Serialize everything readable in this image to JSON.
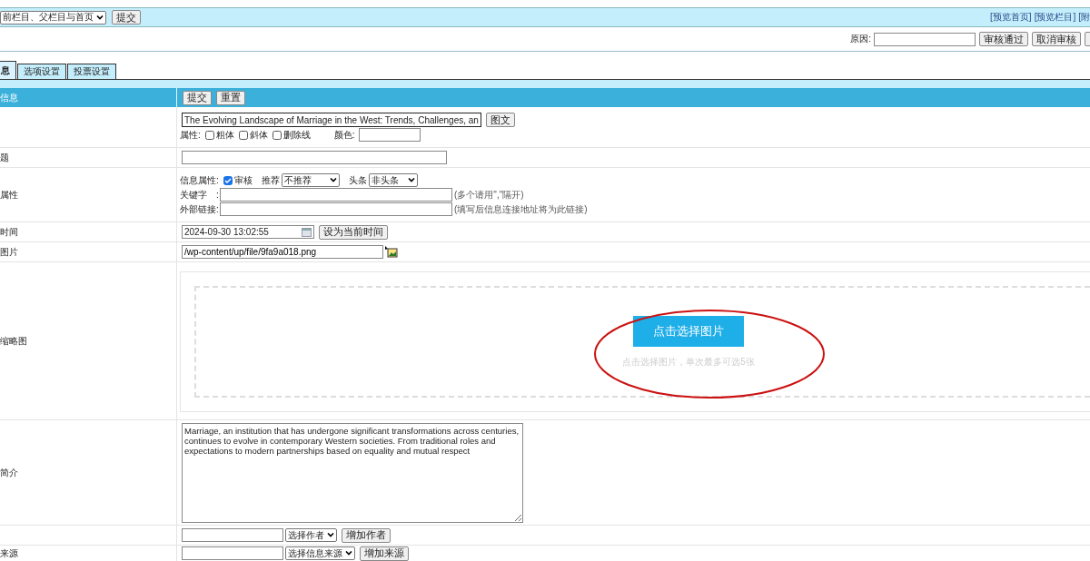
{
  "toolbar": {
    "scope_select": "前栏目、父栏目与首页",
    "submit": "提交",
    "links": [
      "[预览首页]",
      "[预览栏目]",
      "[附"
    ]
  },
  "review": {
    "reason_label": "原因:",
    "buttons": [
      "审核通过",
      "取消审核"
    ]
  },
  "tabs": [
    {
      "label": "息",
      "selected": true
    },
    {
      "label": "选项设置",
      "selected": false
    },
    {
      "label": "投票设置",
      "selected": false
    }
  ],
  "header": {
    "label": "信息",
    "buttons": [
      "提交",
      "重置"
    ]
  },
  "title_row": {
    "value": "The Evolving Landscape of Marriage in the West: Trends, Challenges, an",
    "button": "图文",
    "attr_label": "属性:",
    "styles": [
      {
        "label": "粗体",
        "checked": false
      },
      {
        "label": "斜体",
        "checked": false
      },
      {
        "label": "删除线",
        "checked": false
      }
    ],
    "color_label": "颜色:"
  },
  "subtitle_row": {
    "label": "题"
  },
  "attr_row": {
    "label": "属性",
    "info_label": "信息属性:",
    "review_check": {
      "label": "审核",
      "checked": true
    },
    "recommend_label": "推荐",
    "recommend": "不推荐",
    "headline_label": "头条",
    "headline": "非头条",
    "keyword_label": "关键字　:",
    "keyword_hint": "(多个请用\",\"隔开)",
    "link_label": "外部链接:",
    "link_hint": "(填写后信息连接地址将为此链接)"
  },
  "time_row": {
    "label": "时间",
    "value": "2024-09-30 13:02:55",
    "button": "设为当前时间"
  },
  "picture_row": {
    "label": "图片",
    "value": "/wp-content/up/file/9fa9a018.png"
  },
  "thumb_row": {
    "label": "缩略图",
    "button": "点击选择图片",
    "hint": "点击选择图片，单次最多可选5张"
  },
  "intro_row": {
    "label": "简介",
    "value": "Marriage, an institution that has undergone significant transformations across centuries, continues to evolve in contemporary Western societies. From traditional roles and expectations to modern partnerships based on equality and mutual respect"
  },
  "author_row": {
    "select": "选择作者",
    "button": "增加作者"
  },
  "source_row": {
    "label": "来源",
    "select": "选择信息来源",
    "button": "增加来源"
  }
}
